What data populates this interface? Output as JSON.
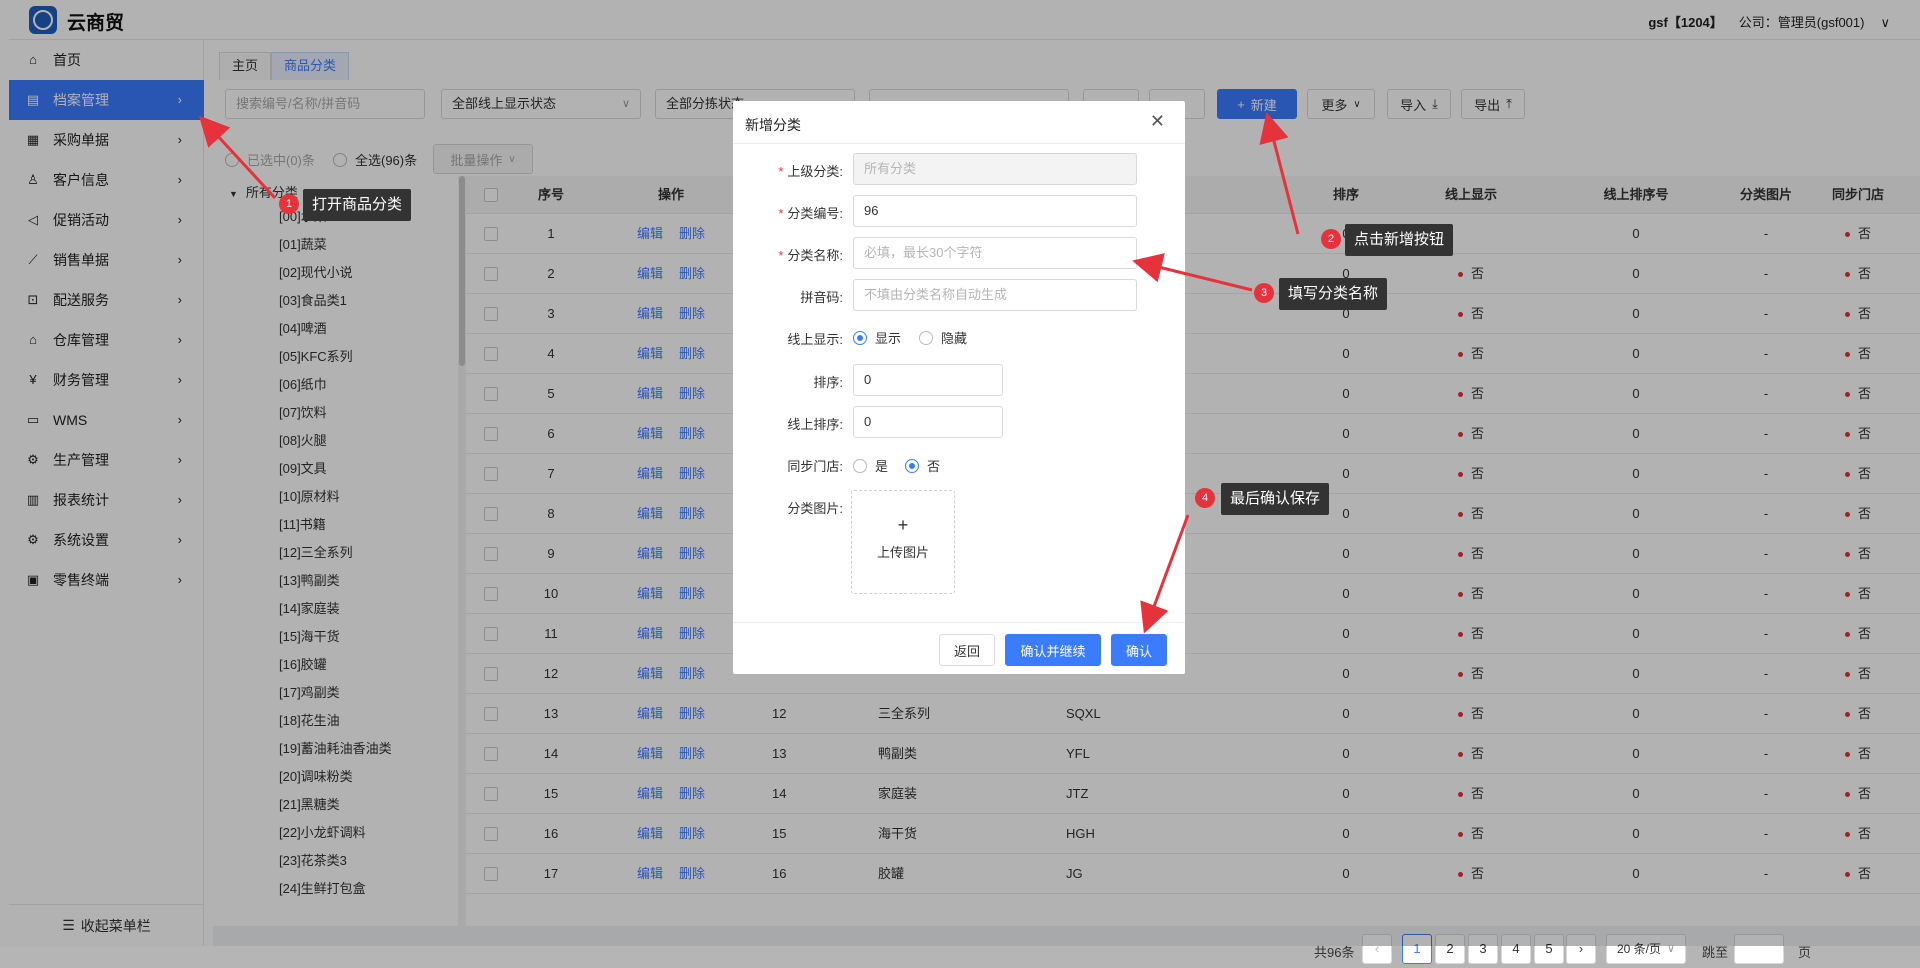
{
  "app": {
    "name": "云商贸",
    "logo_text": "云商",
    "user": "gsf【1204】",
    "company": "公司：管理员(gsf001)"
  },
  "sidebar": {
    "items": [
      {
        "label": "首页",
        "icon": "home-icon",
        "glyph": "⌂",
        "chevron": false
      },
      {
        "label": "档案管理",
        "icon": "archive-icon",
        "glyph": "▤",
        "chevron": true,
        "active": true
      },
      {
        "label": "采购单据",
        "icon": "purchase-icon",
        "glyph": "▦",
        "chevron": true
      },
      {
        "label": "客户信息",
        "icon": "user-icon",
        "glyph": "♙",
        "chevron": true
      },
      {
        "label": "促销活动",
        "icon": "megaphone-icon",
        "glyph": "◁",
        "chevron": true
      },
      {
        "label": "销售单据",
        "icon": "trend-icon",
        "glyph": "⟋",
        "chevron": true
      },
      {
        "label": "配送服务",
        "icon": "cart-icon",
        "glyph": "⊡",
        "chevron": true
      },
      {
        "label": "仓库管理",
        "icon": "warehouse-icon",
        "glyph": "⌂",
        "chevron": true
      },
      {
        "label": "财务管理",
        "icon": "finance-icon",
        "glyph": "¥",
        "chevron": true
      },
      {
        "label": "WMS",
        "icon": "truck-icon",
        "glyph": "▭",
        "chevron": true
      },
      {
        "label": "生产管理",
        "icon": "production-icon",
        "glyph": "⚙",
        "chevron": true
      },
      {
        "label": "报表统计",
        "icon": "chart-icon",
        "glyph": "▥",
        "chevron": true
      },
      {
        "label": "系统设置",
        "icon": "gear-icon",
        "glyph": "⚙",
        "chevron": true
      },
      {
        "label": "零售终端",
        "icon": "bag-icon",
        "glyph": "▣",
        "chevron": true
      }
    ],
    "collapse_label": "收起菜单栏"
  },
  "tabs": [
    {
      "label": "主页"
    },
    {
      "label": "商品分类",
      "active": true
    }
  ],
  "filters": {
    "search_placeholder": "搜索编号/名称/拼音码",
    "online_display": "全部线上显示状态",
    "sort_status": "全部分拣状态",
    "btn_new": "新建",
    "btn_more": "更多",
    "btn_import": "导入",
    "btn_export": "导出",
    "selected": "已选中(0)条",
    "select_all": "全选(96)条",
    "batch": "批量操作"
  },
  "tree": {
    "root": "所有分类",
    "items": [
      "[00]水果",
      "[01]蔬菜",
      "[02]现代小说",
      "[03]食品类1",
      "[04]啤酒",
      "[05]KFC系列",
      "[06]纸巾",
      "[07]饮料",
      "[08]火腿",
      "[09]文具",
      "[10]原材料",
      "[11]书籍",
      "[12]三全系列",
      "[13]鸭副类",
      "[14]家庭装",
      "[15]海干货",
      "[16]胶罐",
      "[17]鸡副类",
      "[18]花生油",
      "[19]蓄油耗油香油类",
      "[20]调味粉类",
      "[21]黑糖类",
      "[22]小龙虾调料",
      "[23]花茶类3",
      "[24]生鲜打包盒"
    ]
  },
  "table": {
    "headers": {
      "seq": "序号",
      "ops": "操作",
      "sort": "排序",
      "online": "线上显示",
      "online_sort": "线上排序号",
      "image": "分类图片",
      "sync": "同步门店"
    },
    "edit": "编辑",
    "del": "删除",
    "rows": [
      {
        "seq": "1",
        "code": "",
        "name": "",
        "pinyin": "",
        "sort": "0",
        "online": "",
        "online_sort": "0",
        "img": "-",
        "sync": "否"
      },
      {
        "seq": "2",
        "code": "",
        "name": "",
        "pinyin": "",
        "sort": "0",
        "online": "否",
        "online_sort": "0",
        "img": "-",
        "sync": "否"
      },
      {
        "seq": "3",
        "code": "",
        "name": "",
        "pinyin": "",
        "sort": "0",
        "online": "否",
        "online_sort": "0",
        "img": "-",
        "sync": "否"
      },
      {
        "seq": "4",
        "code": "",
        "name": "",
        "pinyin": "",
        "sort": "0",
        "online": "否",
        "online_sort": "0",
        "img": "-",
        "sync": "否"
      },
      {
        "seq": "5",
        "code": "",
        "name": "",
        "pinyin": "",
        "sort": "0",
        "online": "否",
        "online_sort": "0",
        "img": "-",
        "sync": "否"
      },
      {
        "seq": "6",
        "code": "",
        "name": "",
        "pinyin": "",
        "sort": "0",
        "online": "否",
        "online_sort": "0",
        "img": "-",
        "sync": "否"
      },
      {
        "seq": "7",
        "code": "",
        "name": "",
        "pinyin": "",
        "sort": "0",
        "online": "否",
        "online_sort": "0",
        "img": "-",
        "sync": "否"
      },
      {
        "seq": "8",
        "code": "",
        "name": "",
        "pinyin": "",
        "sort": "0",
        "online": "否",
        "online_sort": "0",
        "img": "-",
        "sync": "否"
      },
      {
        "seq": "9",
        "code": "",
        "name": "",
        "pinyin": "",
        "sort": "0",
        "online": "否",
        "online_sort": "0",
        "img": "-",
        "sync": "否"
      },
      {
        "seq": "10",
        "code": "",
        "name": "",
        "pinyin": "",
        "sort": "0",
        "online": "否",
        "online_sort": "0",
        "img": "-",
        "sync": "否"
      },
      {
        "seq": "11",
        "code": "",
        "name": "",
        "pinyin": "",
        "sort": "0",
        "online": "否",
        "online_sort": "0",
        "img": "-",
        "sync": "否"
      },
      {
        "seq": "12",
        "code": "",
        "name": "",
        "pinyin": "",
        "sort": "0",
        "online": "否",
        "online_sort": "0",
        "img": "-",
        "sync": "否"
      },
      {
        "seq": "13",
        "code": "12",
        "name": "三全系列",
        "pinyin": "SQXL",
        "sort": "0",
        "online": "否",
        "online_sort": "0",
        "img": "-",
        "sync": "否"
      },
      {
        "seq": "14",
        "code": "13",
        "name": "鸭副类",
        "pinyin": "YFL",
        "sort": "0",
        "online": "否",
        "online_sort": "0",
        "img": "-",
        "sync": "否"
      },
      {
        "seq": "15",
        "code": "14",
        "name": "家庭装",
        "pinyin": "JTZ",
        "sort": "0",
        "online": "否",
        "online_sort": "0",
        "img": "-",
        "sync": "否"
      },
      {
        "seq": "16",
        "code": "15",
        "name": "海干货",
        "pinyin": "HGH",
        "sort": "0",
        "online": "否",
        "online_sort": "0",
        "img": "-",
        "sync": "否"
      },
      {
        "seq": "17",
        "code": "16",
        "name": "胶罐",
        "pinyin": "JG",
        "sort": "0",
        "online": "否",
        "online_sort": "0",
        "img": "-",
        "sync": "否"
      }
    ]
  },
  "pager": {
    "total": "共96条",
    "pages": [
      "1",
      "2",
      "3",
      "4",
      "5"
    ],
    "page_size": "20 条/页",
    "goto": "跳至",
    "unit": "页"
  },
  "modal": {
    "title": "新增分类",
    "parent_label": "上级分类:",
    "parent_value": "所有分类",
    "code_label": "分类编号:",
    "code_value": "96",
    "name_label": "分类名称:",
    "name_placeholder": "必填，最长30个字符",
    "pinyin_label": "拼音码:",
    "pinyin_placeholder": "不填由分类名称自动生成",
    "online_label": "线上显示:",
    "online_show": "显示",
    "online_hide": "隐藏",
    "sort_label": "排序:",
    "sort_value": "0",
    "online_sort_label": "线上排序:",
    "online_sort_value": "0",
    "sync_label": "同步门店:",
    "sync_yes": "是",
    "sync_no": "否",
    "image_label": "分类图片:",
    "upload_label": "上传图片",
    "btn_back": "返回",
    "btn_confirm_continue": "确认并继续",
    "btn_confirm": "确认"
  },
  "callouts": [
    {
      "num": "1",
      "text": "打开商品分类"
    },
    {
      "num": "2",
      "text": "点击新增按钮"
    },
    {
      "num": "3",
      "text": "填写分类名称"
    },
    {
      "num": "4",
      "text": "最后确认保存"
    }
  ]
}
